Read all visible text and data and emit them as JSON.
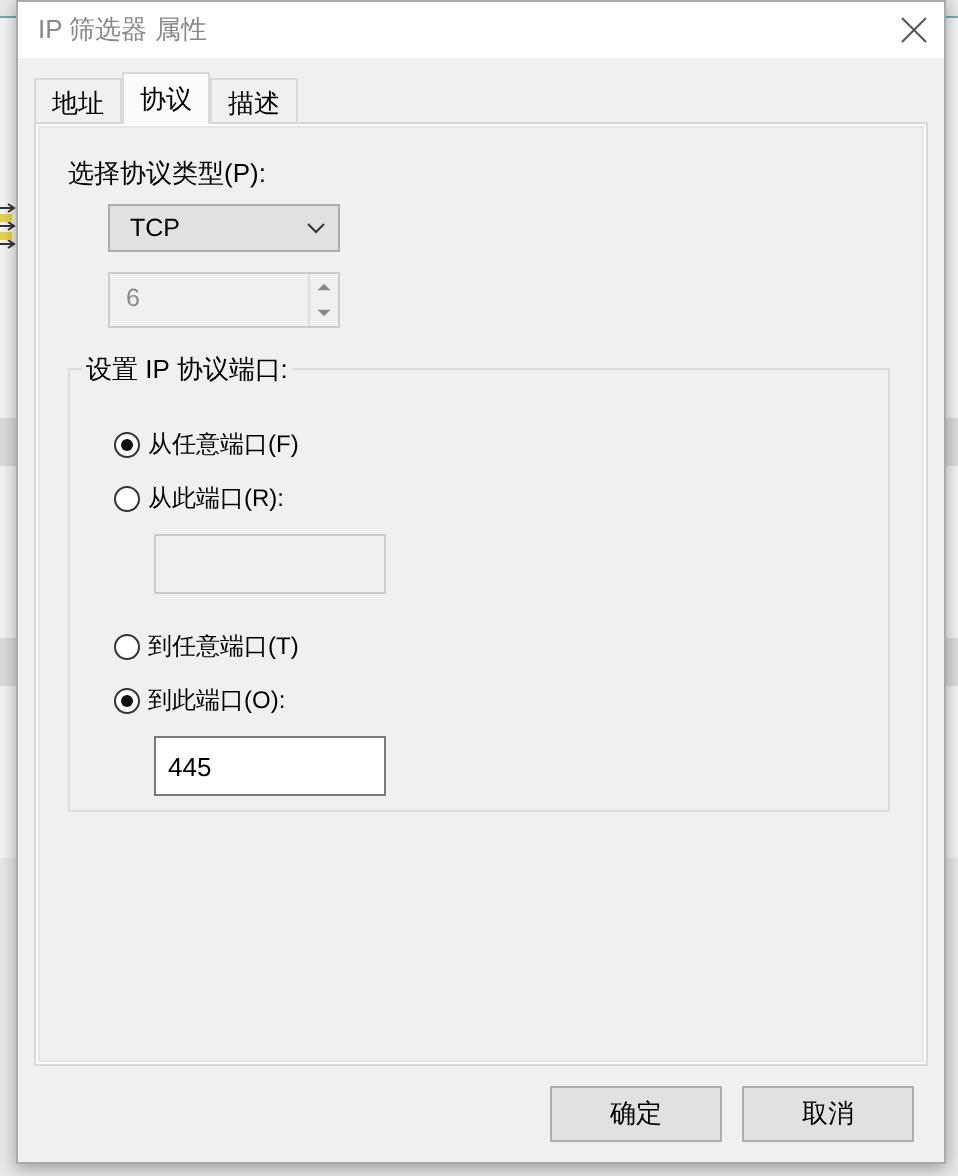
{
  "window": {
    "title": "IP 筛选器 属性"
  },
  "tabs": [
    {
      "label": "地址",
      "selected": false
    },
    {
      "label": "协议",
      "selected": true
    },
    {
      "label": "描述",
      "selected": false
    }
  ],
  "protocol": {
    "label": "选择协议类型(P):",
    "type": "TCP",
    "number": "6",
    "number_disabled": true
  },
  "ports": {
    "title": "设置 IP 协议端口:",
    "options": [
      {
        "label": "从任意端口(F)",
        "selected": true
      },
      {
        "label": "从此端口(R):",
        "selected": false,
        "field": {
          "disabled": true
        }
      },
      {
        "label": "到任意端口(T)",
        "selected": false
      },
      {
        "label": "到此端口(O):",
        "selected": true,
        "field": {
          "value": "445",
          "disabled": false
        }
      }
    ]
  },
  "buttons": [
    "确定",
    "取消"
  ]
}
